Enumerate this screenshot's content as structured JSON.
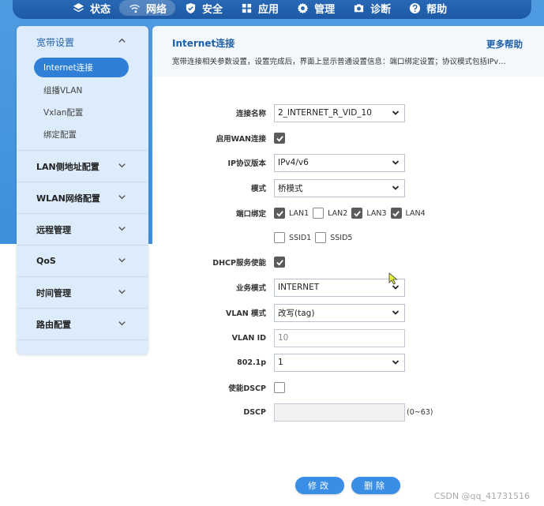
{
  "nav": {
    "items": [
      {
        "label": "状态",
        "icon": "layers-icon",
        "active": false
      },
      {
        "label": "网络",
        "icon": "wifi-icon",
        "active": true
      },
      {
        "label": "安全",
        "icon": "shield-icon",
        "active": false
      },
      {
        "label": "应用",
        "icon": "grid-icon",
        "active": false
      },
      {
        "label": "管理",
        "icon": "gear-icon",
        "active": false
      },
      {
        "label": "诊断",
        "icon": "camera-icon",
        "active": false
      },
      {
        "label": "帮助",
        "icon": "question-icon",
        "active": false
      }
    ]
  },
  "sidebar": {
    "open_group": {
      "label": "宽带设置",
      "items": [
        "Internet连接",
        "组播VLAN",
        "Vxlan配置",
        "绑定配置"
      ],
      "active_index": 0
    },
    "groups": [
      "LAN侧地址配置",
      "WLAN网络配置",
      "远程管理",
      "QoS",
      "时间管理",
      "路由配置"
    ]
  },
  "main": {
    "title": "Internet连接",
    "help": "更多帮助",
    "description": "宽带连接相关参数设置，设置完成后，界面上显示普通设置信息：端口绑定设置；协议模式包括IPv…"
  },
  "form": {
    "connection_name": {
      "label": "连接名称",
      "value": "2_INTERNET_R_VID_10"
    },
    "enable_wan": {
      "label": "启用WAN连接",
      "checked": true
    },
    "ip_version": {
      "label": "IP协议版本",
      "value": "IPv4/v6"
    },
    "mode": {
      "label": "模式",
      "value": "桥模式"
    },
    "port_binding": {
      "label": "端口绑定",
      "ports": [
        {
          "name": "LAN1",
          "checked": true
        },
        {
          "name": "LAN2",
          "checked": false
        },
        {
          "name": "LAN3",
          "checked": true
        },
        {
          "name": "LAN4",
          "checked": true
        }
      ],
      "ssids": [
        {
          "name": "SSID1",
          "checked": false
        },
        {
          "name": "SSID5",
          "checked": false
        }
      ]
    },
    "dhcp": {
      "label": "DHCP服务使能",
      "checked": true
    },
    "service_mode": {
      "label": "业务模式",
      "value": "INTERNET"
    },
    "vlan_mode": {
      "label": "VLAN 模式",
      "value": "改写(tag)"
    },
    "vlan_id": {
      "label": "VLAN ID",
      "value": "10"
    },
    "dot1p": {
      "label": "802.1p",
      "value": "1"
    },
    "enable_dscp": {
      "label": "使能DSCP",
      "checked": false
    },
    "dscp": {
      "label": "DSCP",
      "value": "",
      "hint": "(0~63)"
    }
  },
  "buttons": {
    "modify": "修改",
    "delete": "删除"
  },
  "watermark": "CSDN @qq_41731516"
}
